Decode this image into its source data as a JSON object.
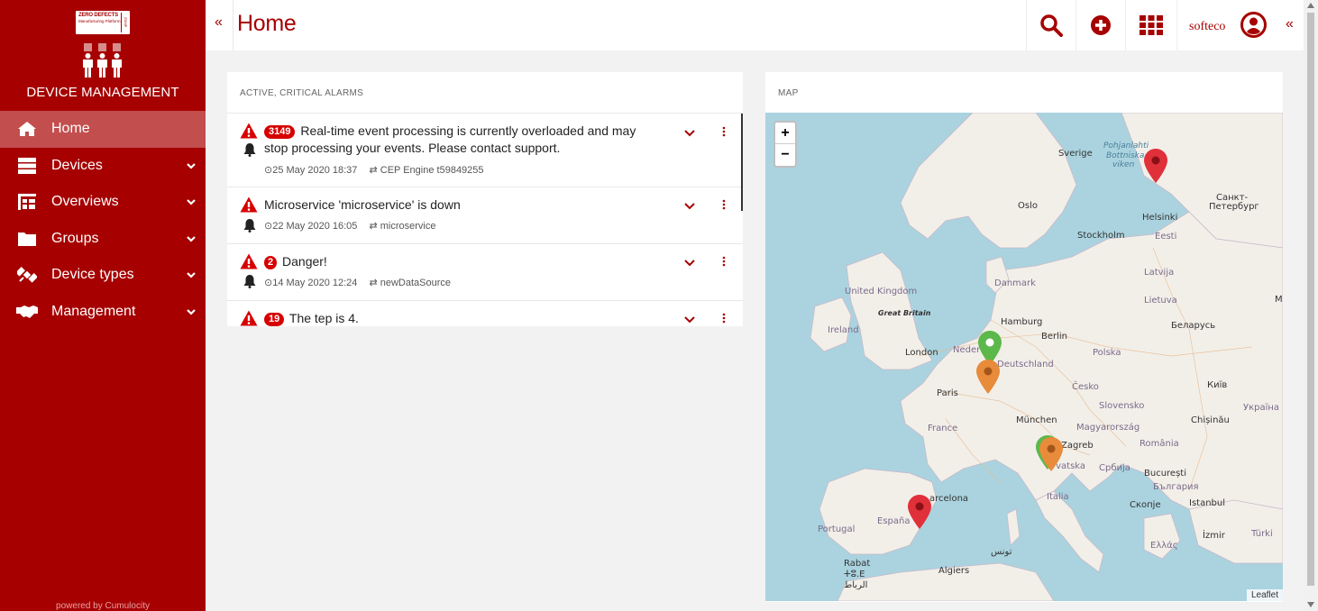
{
  "sidebar": {
    "logo": {
      "line1": "ZERO DEFECTS",
      "line2": "Manufacturing Platform",
      "side": "ZDMP"
    },
    "title": "DEVICE MANAGEMENT",
    "items": [
      {
        "label": "Home",
        "icon": "home-icon",
        "active": true
      },
      {
        "label": "Devices",
        "icon": "devices-icon"
      },
      {
        "label": "Overviews",
        "icon": "overviews-icon"
      },
      {
        "label": "Groups",
        "icon": "folder-icon"
      },
      {
        "label": "Device types",
        "icon": "satellite-icon"
      },
      {
        "label": "Management",
        "icon": "handshake-icon"
      }
    ],
    "powered": "powered by Cumulocity"
  },
  "header": {
    "collapse_left": "«",
    "title": "Home",
    "user": "softeco",
    "collapse_right": "«"
  },
  "alarms": {
    "title": "ACTIVE, CRITICAL ALARMS",
    "items": [
      {
        "count": "3149",
        "text": "Real-time event processing is currently overloaded and may stop processing your events. Please contact support.",
        "time": "25 May 2020 18:37",
        "source": "CEP Engine t59849255"
      },
      {
        "count": "",
        "text": "Microservice 'microservice' is down",
        "time": "22 May 2020 16:05",
        "source": "microservice"
      },
      {
        "count": "2",
        "text": "Danger!",
        "time": "14 May 2020 12:24",
        "source": "newDataSource"
      },
      {
        "count": "19",
        "text": "The tep is 4.",
        "time": "",
        "source": ""
      }
    ]
  },
  "map": {
    "title": "MAP",
    "zoom_in": "+",
    "zoom_out": "−",
    "attribution": "Leaflet",
    "labels": {
      "sverige": "Sverige",
      "pohjanlahti": "Pohjanlahti",
      "bottniska": "Bottniska",
      "viken": "viken",
      "spb1": "Санкт-",
      "spb2": "Петербург",
      "oslo": "Oslo",
      "helsinki": "Helsinki",
      "stockholm": "Stockholm",
      "eesti": "Eesti",
      "latvija": "Latvija",
      "lietuva": "Lietuva",
      "danmark": "Danmark",
      "uk": "United Kingdom",
      "gb": "Great Britain",
      "ireland": "Ireland",
      "hamburg": "Hamburg",
      "berlin": "Berlin",
      "polska": "Polska",
      "belarus": "Беларусь",
      "london": "London",
      "nederland": "Neder",
      "deutschland": "Deutschland",
      "paris": "Paris",
      "cesko": "Česko",
      "kyiv": "Київ",
      "slovensko": "Slovensko",
      "ukraina": "Україна",
      "france": "France",
      "munchen": "München",
      "magyar": "Magyarország",
      "chisinau": "Chișinău",
      "zagreb": "Zagreb",
      "romania": "România",
      "hrvatska": "rvatska",
      "srbija": "Србија",
      "bucuresti": "București",
      "balgariya": "България",
      "barcelona": "arcelona",
      "italia": "Italia",
      "skopje": "Скопје",
      "istanbul": "Istanbul",
      "portugal": "Portugal",
      "espana": "España",
      "izmir": "İzmir",
      "turkiye": "Türki",
      "ellas": "Ελλάς",
      "tunis": "تونس",
      "rabat": "Rabat",
      "oe": "ⵜⵓ.E",
      "rabat_ar": "الرباط",
      "algiers": "Algiers",
      "m": "M"
    }
  },
  "colors": {
    "brand": "#a60000",
    "active": "#c24e4e",
    "badge": "#d60000",
    "sea": "#aad3df",
    "land": "#f2efe9"
  }
}
